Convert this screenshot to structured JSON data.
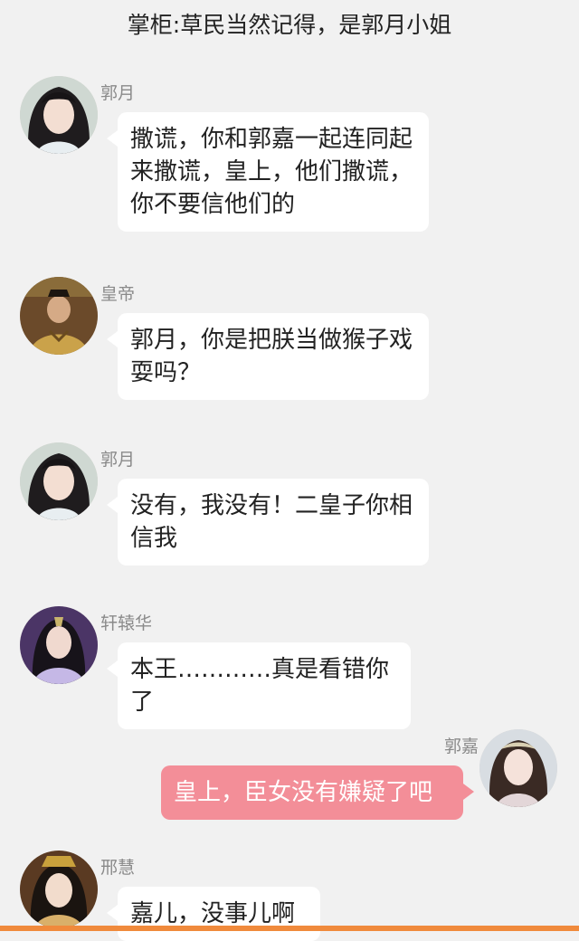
{
  "header": {
    "text": "掌柜:草民当然记得，是郭月小姐"
  },
  "messages": [
    {
      "side": "left",
      "name": "郭月",
      "text": "撒谎，你和郭嘉一起连同起来撒谎，皇上，他们撒谎，你不要信他们的",
      "avatar": "woman-avatar"
    },
    {
      "side": "left",
      "name": "皇帝",
      "text": "郭月，你是把朕当做猴子戏耍吗？",
      "avatar": "emperor-avatar"
    },
    {
      "side": "left",
      "name": "郭月",
      "text": "没有，我没有！二皇子你相信我",
      "avatar": "woman-avatar"
    },
    {
      "side": "left",
      "name": "轩辕华",
      "text": "本王…………真是看错你了",
      "avatar": "prince-avatar"
    },
    {
      "side": "right",
      "name": "郭嘉",
      "text": "皇上，臣女没有嫌疑了吧",
      "avatar": "lady-avatar"
    },
    {
      "side": "left",
      "name": "邢慧",
      "text": "嘉儿，没事儿啊",
      "avatar": "consort-avatar"
    }
  ],
  "colors": {
    "background": "#f1f1f1",
    "bubble_left": "#ffffff",
    "bubble_right": "#f38e98",
    "bottom_bar": "#f08a3c"
  }
}
